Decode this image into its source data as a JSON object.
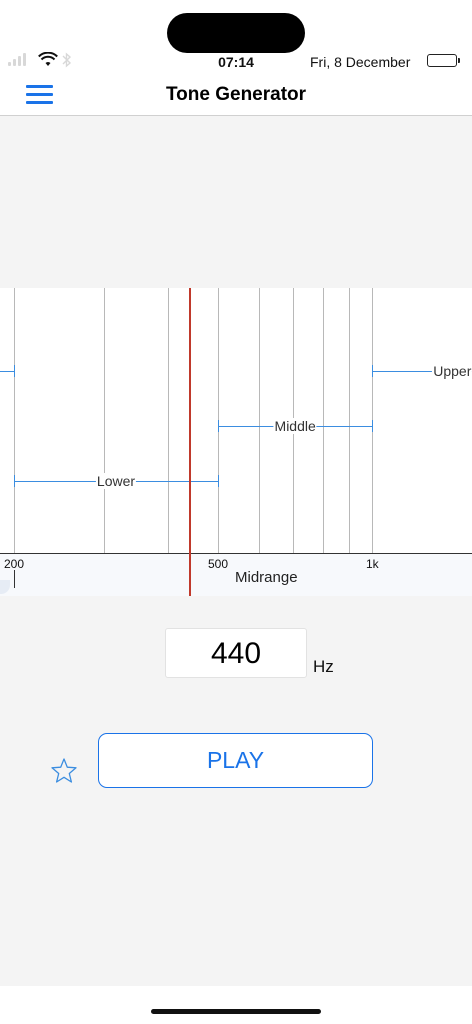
{
  "status": {
    "time": "07:14",
    "date": "Fri, 8 December"
  },
  "header": {
    "title": "Tone Generator"
  },
  "chart": {
    "ticks": [
      {
        "label": "200",
        "hz": 200
      },
      {
        "label": "500",
        "hz": 500
      },
      {
        "label": "1k",
        "hz": 1000
      }
    ],
    "ranges": [
      {
        "label": "Lower",
        "from_hz": 200,
        "to_hz": 500
      },
      {
        "label": "Middle",
        "from_hz": 500,
        "to_hz": 1000
      },
      {
        "label": "Upper",
        "from_hz": 1000
      }
    ],
    "band_label": "Midrange",
    "marker_hz": 440
  },
  "frequency": {
    "value": "440",
    "unit": "Hz"
  },
  "play": {
    "label": "PLAY"
  },
  "colors": {
    "accent": "#1a73e8",
    "marker": "#c0392b",
    "range": "#3b8de0"
  }
}
